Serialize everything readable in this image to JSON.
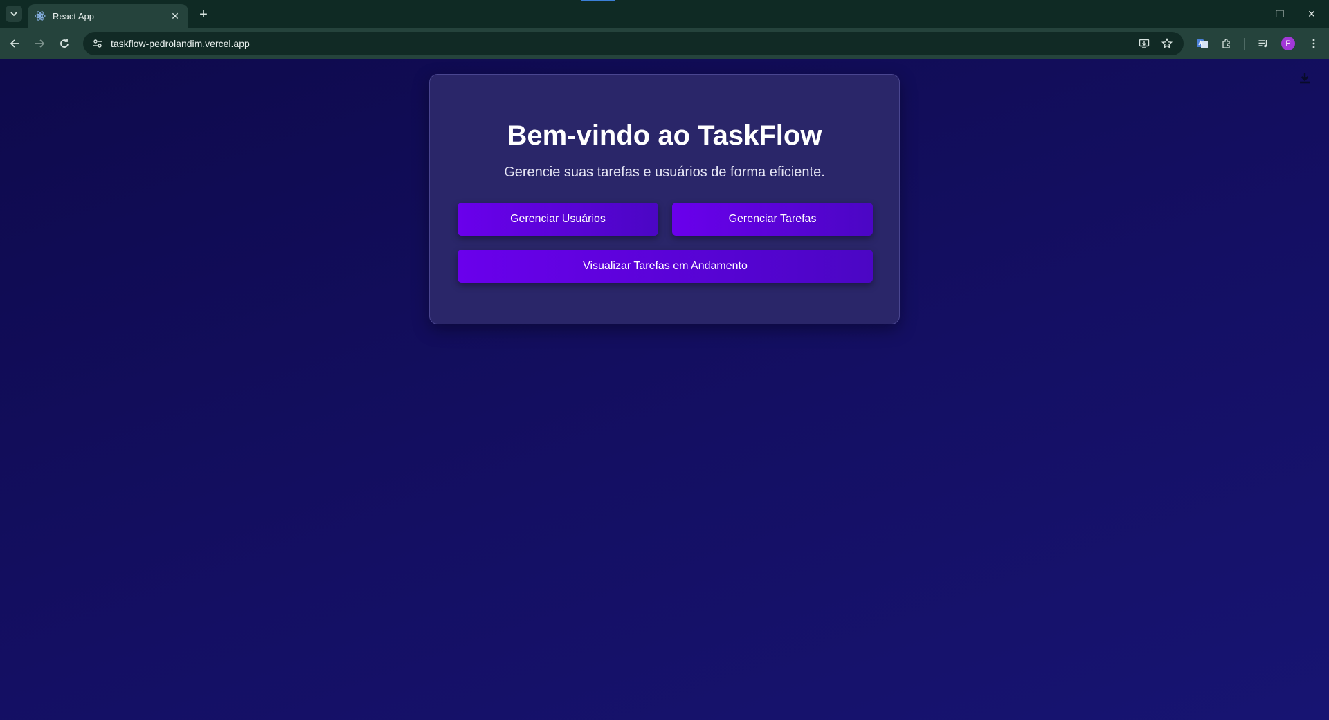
{
  "browser": {
    "tab": {
      "title": "React App",
      "favicon": "react-atom-icon"
    },
    "url": "taskflow-pedrolandim.vercel.app",
    "avatar_initial": "P",
    "colors": {
      "frame": "#0f2a24",
      "toolbar": "#25433c",
      "omnibox": "#112a25",
      "avatar": "#a238d8"
    }
  },
  "page": {
    "title": "Bem-vindo ao TaskFlow",
    "subtitle": "Gerencie suas tarefas e usuários de forma eficiente.",
    "buttons": {
      "users": "Gerenciar Usuários",
      "tasks": "Gerenciar Tarefas",
      "in_progress": "Visualizar Tarefas em Andamento"
    },
    "colors": {
      "background": "#140f63",
      "card": "#2a2669",
      "button_start": "#6a00ec",
      "button_end": "#4b06c4"
    }
  }
}
